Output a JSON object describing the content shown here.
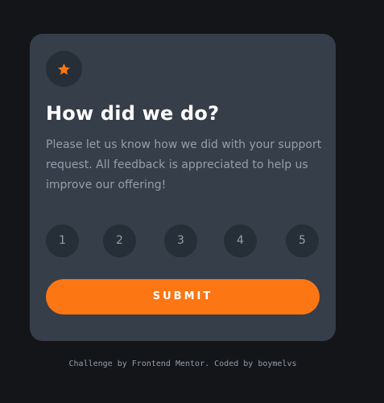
{
  "card": {
    "icon": "star-icon",
    "title": "How did we do?",
    "description": "Please let us know how we did with your support request. All feedback is appreciated to help us improve our offering!",
    "ratings": [
      "1",
      "2",
      "3",
      "4",
      "5"
    ],
    "submit_label": "SUBMIT"
  },
  "footer": {
    "attribution": "Challenge by Frontend Mentor. Coded by boymelvs"
  },
  "colors": {
    "page_background": "#131518",
    "card_background": "#363e4a",
    "button_background": "#262e38",
    "accent": "#fc7614",
    "text_muted": "#959eac",
    "text_heading": "#ffffff"
  }
}
